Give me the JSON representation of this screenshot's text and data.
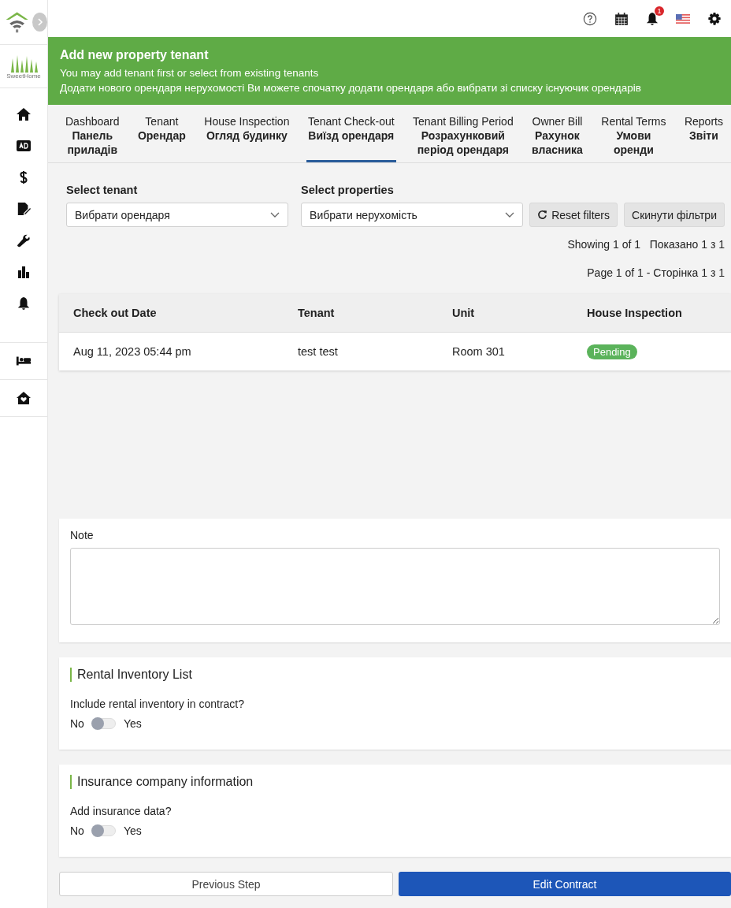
{
  "sidebar": {
    "logo_text": "SweetHome"
  },
  "top_bar": {
    "notification_count": "1"
  },
  "banner": {
    "title": "Add new property tenant",
    "subtitle": "You may add tenant first or select from existing tenants",
    "subtitle_uk": "Додати нового орендаря нерухомості  Ви можете спочатку додати орендаря або вибрати зі списку існуючик орендарів"
  },
  "tabs": [
    {
      "label": "Dashboard",
      "label_uk": "Панель приладів",
      "selected": false
    },
    {
      "label": "Tenant",
      "label_uk": "Орендар",
      "selected": false
    },
    {
      "label": "House Inspection",
      "label_uk": "Огляд будинку",
      "selected": false
    },
    {
      "label": "Tenant Check-out",
      "label_uk": "Виїзд орендаря",
      "selected": true
    },
    {
      "label": "Tenant Billing Period",
      "label_uk": "Розрахунковий період орендаря",
      "selected": false
    },
    {
      "label": "Owner Bill",
      "label_uk": "Рахунок власника",
      "selected": false
    },
    {
      "label": "Rental Terms",
      "label_uk": "Умови оренди",
      "selected": false
    },
    {
      "label": "Reports",
      "label_uk": "Звіти",
      "selected": false
    }
  ],
  "filters": {
    "tenant_label": "Select tenant",
    "tenant_placeholder": "Вибрати орендаря",
    "properties_label": "Select properties",
    "properties_placeholder": "Вибрати нерухомість",
    "reset_button": "Reset filters",
    "reset_button_uk": "Скинути фільтри"
  },
  "showing": "Showing 1 of 1   Показано 1 з 1",
  "page_info": "Page 1 of 1 - Сторінка 1 з 1",
  "table": {
    "columns": [
      "Check out Date",
      "Tenant",
      "Unit",
      "House Inspection"
    ],
    "rows": [
      {
        "date": "Aug 11, 2023 05:44 pm",
        "tenant": "test test",
        "unit": "Room 301",
        "status": "Pending"
      }
    ]
  },
  "note": {
    "label": "Note"
  },
  "sections": [
    {
      "title": "Rental Inventory List",
      "question": "Include rental inventory in contract?",
      "off_label": "No",
      "on_label": "Yes",
      "on": false
    },
    {
      "title": "Insurance company information",
      "question": "Add insurance data?",
      "off_label": "No",
      "on_label": "Yes",
      "on": false
    }
  ],
  "buttons": {
    "previous": "Previous Step",
    "edit": "Edit Contract"
  }
}
